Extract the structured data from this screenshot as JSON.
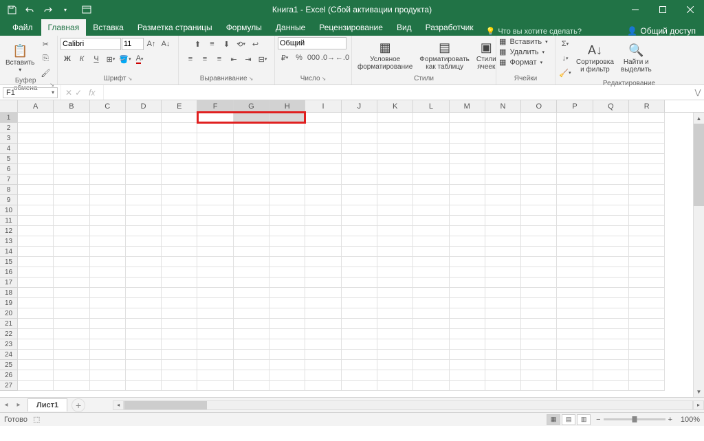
{
  "title": "Книга1 - Excel (Сбой активации продукта)",
  "tabs": {
    "file": "Файл",
    "home": "Главная",
    "insert": "Вставка",
    "pagelayout": "Разметка страницы",
    "formulas": "Формулы",
    "data": "Данные",
    "review": "Рецензирование",
    "view": "Вид",
    "developer": "Разработчик"
  },
  "tellme": "Что вы хотите сделать?",
  "share": "Общий доступ",
  "ribbon": {
    "clipboard": {
      "label": "Буфер обмена",
      "paste": "Вставить"
    },
    "font": {
      "label": "Шрифт",
      "name": "Calibri",
      "size": "11"
    },
    "alignment": {
      "label": "Выравнивание"
    },
    "number": {
      "label": "Число",
      "format": "Общий"
    },
    "styles": {
      "label": "Стили",
      "conditional": "Условное\nформатирование",
      "astable": "Форматировать\nкак таблицу",
      "cellstyles": "Стили\nячеек"
    },
    "cells": {
      "label": "Ячейки",
      "insert": "Вставить",
      "delete": "Удалить",
      "format": "Формат"
    },
    "editing": {
      "label": "Редактирование",
      "sortfilter": "Сортировка\nи фильтр",
      "findselect": "Найти и\nвыделить"
    }
  },
  "namebox": "F1",
  "columns": [
    "A",
    "B",
    "C",
    "D",
    "E",
    "F",
    "G",
    "H",
    "I",
    "J",
    "K",
    "L",
    "M",
    "N",
    "O",
    "P",
    "Q",
    "R"
  ],
  "selected_cols": [
    "F",
    "G",
    "H"
  ],
  "rowcount": 27,
  "selected_row": 1,
  "sheet": "Лист1",
  "status": "Готово",
  "zoom": "100%"
}
